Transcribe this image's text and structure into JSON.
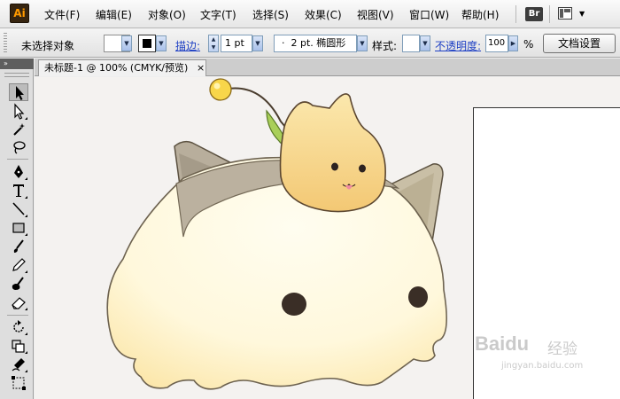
{
  "app": {
    "logo": "Ai"
  },
  "menubar": {
    "items": [
      {
        "label": "文件(F)",
        "key": "F"
      },
      {
        "label": "编辑(E)",
        "key": "E"
      },
      {
        "label": "对象(O)",
        "key": "O"
      },
      {
        "label": "文字(T)",
        "key": "T"
      },
      {
        "label": "选择(S)",
        "key": "S"
      },
      {
        "label": "效果(C)",
        "key": "C"
      },
      {
        "label": "视图(V)",
        "key": "V"
      },
      {
        "label": "窗口(W)",
        "key": "W"
      },
      {
        "label": "帮助(H)",
        "key": "H"
      }
    ],
    "bridge_label": "Br"
  },
  "controlbar": {
    "selection_status": "未选择对象",
    "stroke_label": "描边:",
    "stroke_weight": "1 pt",
    "brush_label": "2 pt. 椭圆形",
    "style_label": "样式:",
    "opacity_label": "不透明度:",
    "opacity_value": "100",
    "opacity_unit": "%",
    "doc_setup_label": "文档设置"
  },
  "tools_panel": {
    "collapse_glyph": "»"
  },
  "document": {
    "tab_title": "未标题-1 @ 100% (CMYK/预览)",
    "close_glyph": "×"
  },
  "watermark": {
    "brand": "Baidu",
    "brand_cn": "经验",
    "url": "jingyan.baidu.com"
  },
  "colors": {
    "canvas_bg": "#f4f2f0",
    "body_cream": "#fff9dc",
    "body_shadow": "#fbe9b0",
    "ear_gray": "#b5aa98",
    "cat_yellow": "#f6d58c",
    "leaf_green": "#a9cf59",
    "bulb_yellow": "#f8d64a",
    "link_blue": "#1d3fc4"
  },
  "icons": [
    "selection-tool-icon",
    "direct-selection-icon",
    "magic-wand-icon",
    "lasso-icon",
    "pen-icon",
    "type-icon",
    "line-icon",
    "rectangle-icon",
    "paintbrush-icon",
    "pencil-icon",
    "blob-brush-icon",
    "eraser-icon",
    "rotate-icon",
    "scale-icon",
    "warp-icon",
    "free-transform-icon"
  ]
}
